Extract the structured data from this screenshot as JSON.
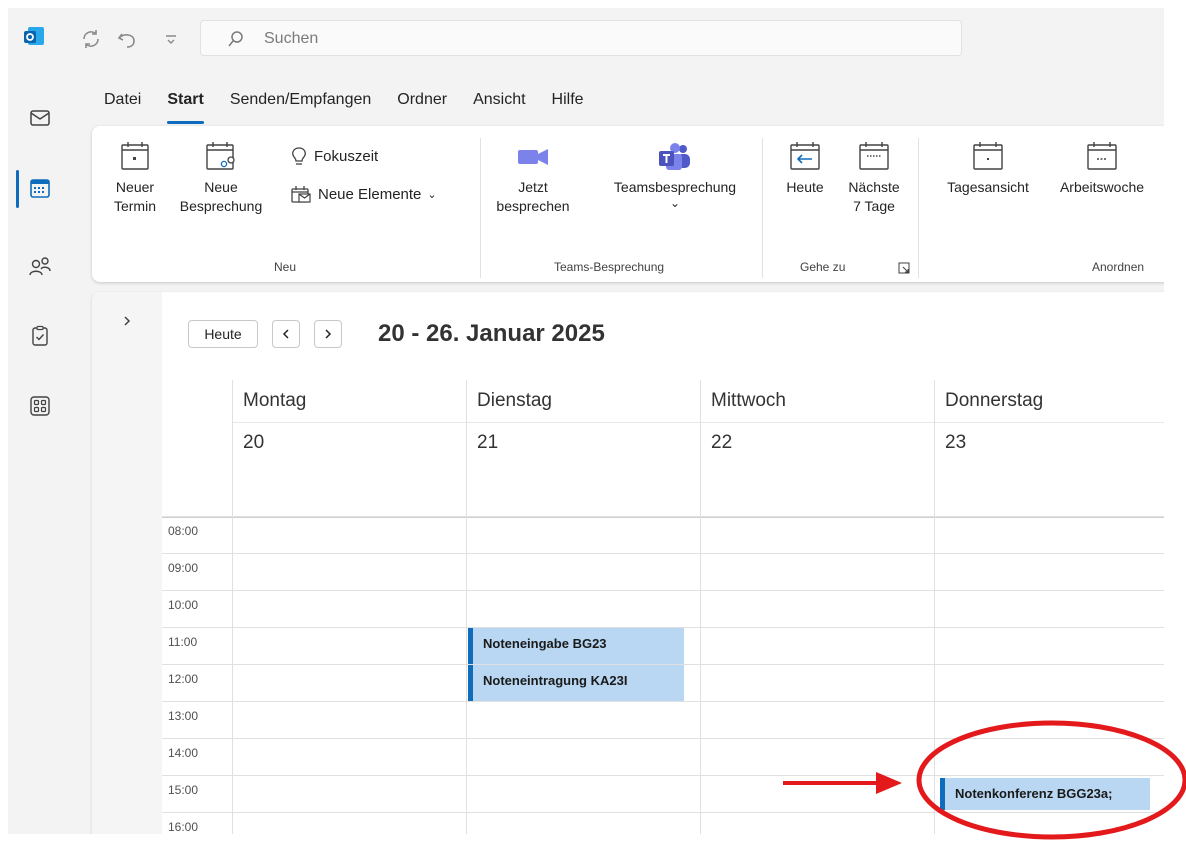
{
  "titlebar": {
    "search_placeholder": "Suchen"
  },
  "menu_tabs": [
    "Datei",
    "Start",
    "Senden/Empfangen",
    "Ordner",
    "Ansicht",
    "Hilfe"
  ],
  "ribbon": {
    "neu": {
      "new_appointment": [
        "Neuer",
        "Termin"
      ],
      "new_meeting": [
        "Neue",
        "Besprechung"
      ],
      "focus_time": "Fokuszeit",
      "new_items": "Neue Elemente",
      "label": "Neu"
    },
    "teams": {
      "meet_now": [
        "Jetzt",
        "besprechen"
      ],
      "teams_meeting": "Teamsbesprechung",
      "label": "Teams-Besprechung"
    },
    "gehe_zu": {
      "today": "Heute",
      "next7": [
        "Nächste",
        "7 Tage"
      ],
      "label": "Gehe zu"
    },
    "anordnen": {
      "day_view": "Tagesansicht",
      "work_week": "Arbeitswoche",
      "label": "Anordnen"
    }
  },
  "calendar": {
    "today_button": "Heute",
    "prev": "<",
    "next": ">",
    "date_range": "20 - 26. Januar 2025",
    "days": [
      {
        "name": "Montag",
        "num": "20"
      },
      {
        "name": "Dienstag",
        "num": "21"
      },
      {
        "name": "Mittwoch",
        "num": "22"
      },
      {
        "name": "Donnerstag",
        "num": "23"
      }
    ],
    "hours": [
      "08:00",
      "09:00",
      "10:00",
      "11:00",
      "12:00",
      "13:00",
      "14:00",
      "15:00",
      "16:00"
    ],
    "events": [
      {
        "title": "Noteneingabe BG23",
        "day": "Dienstag",
        "start": "11:00"
      },
      {
        "title": "Noteneintragung KA23I",
        "day": "Dienstag",
        "start": "12:00"
      },
      {
        "title": "Notenkonferenz BGG23a;",
        "day": "Donnerstag",
        "start": "15:00"
      }
    ]
  },
  "colors": {
    "accent": "#0f6cbd",
    "event_fill": "#b9d7f2",
    "annotation": "#e3191b"
  }
}
